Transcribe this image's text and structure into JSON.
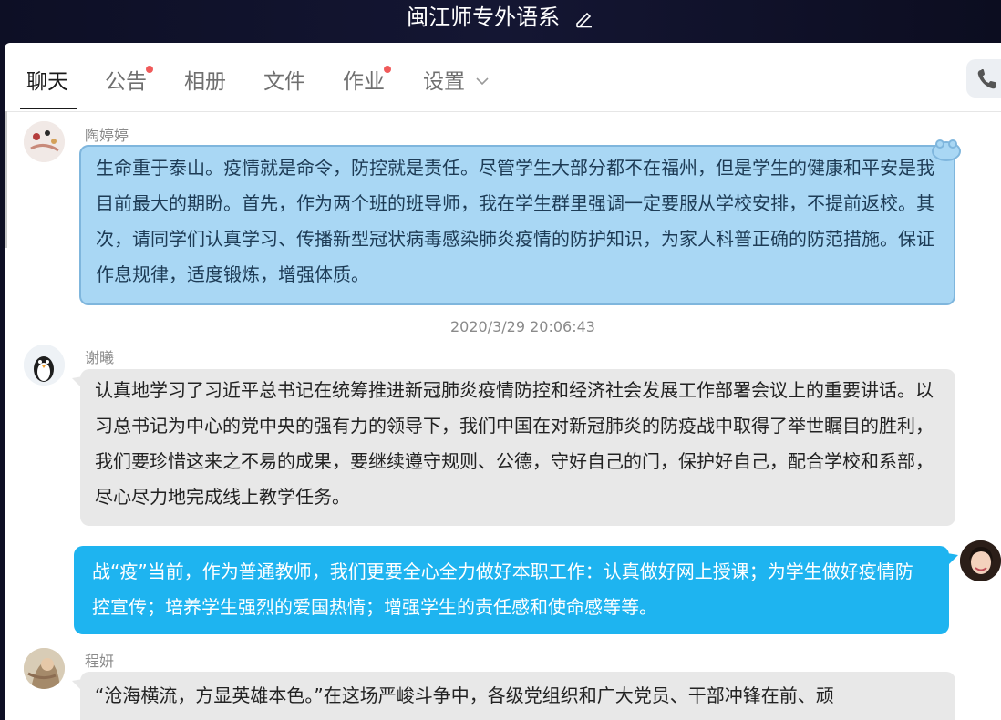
{
  "window": {
    "title": "闽江师专外语系"
  },
  "tabs": [
    {
      "label": "聊天",
      "active": true,
      "badge": false
    },
    {
      "label": "公告",
      "active": false,
      "badge": true
    },
    {
      "label": "相册",
      "active": false,
      "badge": false
    },
    {
      "label": "文件",
      "active": false,
      "badge": false
    },
    {
      "label": "作业",
      "active": false,
      "badge": true
    },
    {
      "label": "设置",
      "active": false,
      "badge": false,
      "has_dropdown": true
    }
  ],
  "header_actions": {
    "call_icon": "phone-icon"
  },
  "messages": [
    {
      "sender": "陶婷婷",
      "text": "生命重于泰山。疫情就是命令，防控就是责任。尽管学生大部分都不在福州，但是学生的健康和平安是我目前最大的期盼。首先，作为两个班的班导师，我在学生群里强调一定要服从学校安排，不提前返校。其次，请同学们认真学习、传播新型冠状病毒感染肺炎疫情的防护知识，为家人科普正确的防范措施。保证作息规律，适度锻炼，增强体质。",
      "style": "bubble-theme"
    },
    {
      "timestamp": "2020/3/29 20:06:43"
    },
    {
      "sender": "谢曦",
      "text": "认真地学习了习近平总书记在统筹推进新冠肺炎疫情防控和经济社会发展工作部署会议上的重要讲话。以习总书记为中心的党中央的强有力的领导下，我们中国在对新冠肺炎的防疫战中取得了举世瞩目的胜利，我们要珍惜这来之不易的成果，要继续遵守规则、公德，守好自己的门，保护好自己，配合学校和系部，尽心尽力地完成线上教学任务。",
      "style": "default"
    },
    {
      "sender": "",
      "text": "战“疫”当前，作为普通教师，我们更要全心全力做好本职工作：认真做好网上授课；为学生做好疫情防控宣传；培养学生强烈的爱国热情；增强学生的责任感和使命感等等。",
      "style": "self"
    },
    {
      "sender": "程妍",
      "text": "“沧海横流，方显英雄本色。”在这场严峻斗争中，各级党组织和广大党员、干部冲锋在前、顽",
      "style": "default"
    }
  ],
  "colors": {
    "accent_blue": "#1eb4f0",
    "theme_bubble": "#a9d7f4",
    "badge_red": "#f05a5a",
    "default_bubble": "#e8e8e8"
  }
}
